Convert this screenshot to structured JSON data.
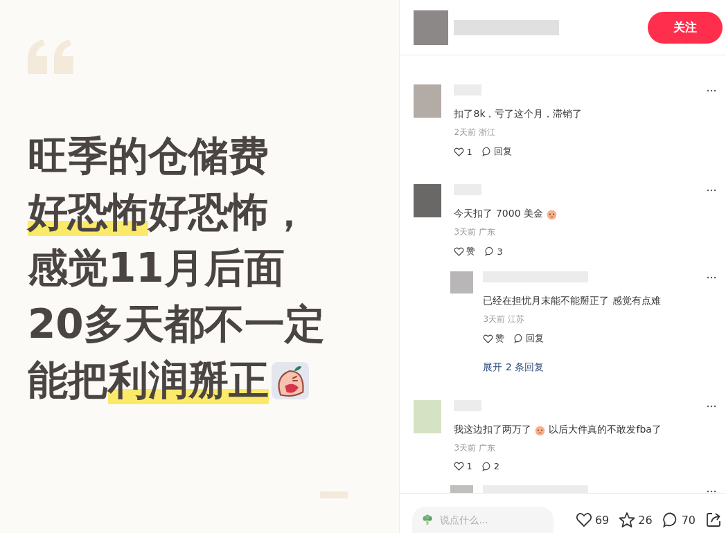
{
  "post_card": {
    "lines": [
      [
        {
          "text": "旺季的仓储费",
          "highlighted": false
        }
      ],
      [
        {
          "text": "好恐怖",
          "highlighted": true
        },
        {
          "text": "好恐怖，",
          "highlighted": false
        }
      ],
      [
        {
          "text": "感觉11月后面",
          "highlighted": false
        }
      ],
      [
        {
          "text": "20多天都不一定",
          "highlighted": false
        }
      ],
      [
        {
          "text": "能把",
          "highlighted": false
        },
        {
          "text": "利润掰正",
          "highlighted": true
        },
        {
          "kind": "emoji"
        }
      ]
    ]
  },
  "header": {
    "follow_button": "关注"
  },
  "comments": [
    {
      "parts": [
        {
          "kind": "text",
          "text": "扣了8k，亏了这个月，滞销了"
        }
      ],
      "meta": "2天前 浙江",
      "like_label": "1",
      "reply_label": "回复"
    },
    {
      "parts": [
        {
          "kind": "text",
          "text": "今天扣了 7000 美金"
        },
        {
          "kind": "emoji"
        }
      ],
      "meta": "3天前 广东",
      "like_label": "赞",
      "reply_label": "3",
      "replies": [
        {
          "kind": "full",
          "parts": [
            {
              "kind": "text",
              "text": "已经在担忧月末能不能掰正了 感觉有点难"
            }
          ],
          "meta": "3天前 江苏",
          "like_label": "赞",
          "reply_label": "回复"
        }
      ],
      "expand": "展开 2 条回复"
    },
    {
      "parts": [
        {
          "kind": "text",
          "text": "我这边扣了两万了"
        },
        {
          "kind": "emoji"
        },
        {
          "kind": "text",
          "text": "以后大件真的不敢发fba了"
        }
      ],
      "meta": "3天前 广东",
      "like_label": "1",
      "reply_label": "2",
      "replies": [
        {
          "kind": "cut"
        }
      ]
    }
  ],
  "footer": {
    "input": {
      "placeholder": "说点什么..."
    },
    "likes": "69",
    "stars": "26",
    "comments": "70"
  }
}
